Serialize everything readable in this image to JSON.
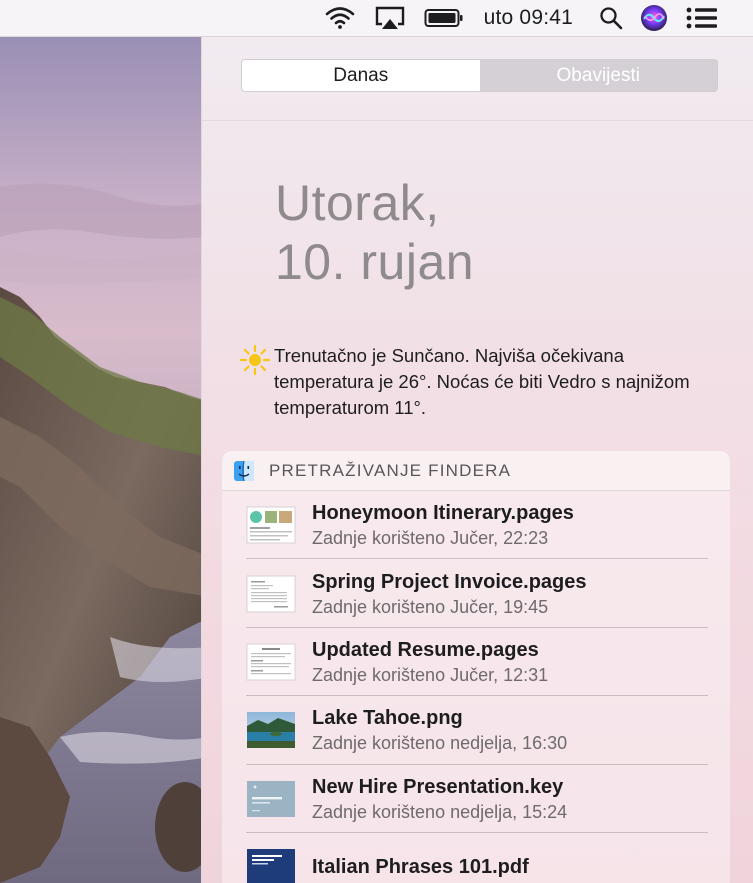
{
  "menubar": {
    "icons": [
      "wifi-icon",
      "airplay-icon",
      "battery-icon",
      "search-icon",
      "siri-icon",
      "notification-center-icon"
    ],
    "clock": "uto 09:41"
  },
  "panel": {
    "tabs": [
      {
        "label": "Danas",
        "active": true
      },
      {
        "label": "Obavijesti",
        "active": false
      }
    ],
    "date_line1": "Utorak,",
    "date_line2": "10. rujan",
    "weather": {
      "icon": "sun-icon",
      "text": "Trenutačno je Sunčano. Najviša očekivana temperatura je 26°. Noćas će biti Vedro s najnižom temperaturom 11°."
    },
    "finder_widget": {
      "icon": "finder-icon",
      "title": "PRETRAŽIVANJE FINDERA",
      "results": [
        {
          "name": "Honeymoon Itinerary.pages",
          "meta": "Zadnje korišteno Jučer, 22:23",
          "thumb": "pages-document-thumbnail"
        },
        {
          "name": "Spring Project Invoice.pages",
          "meta": "Zadnje korišteno Jučer, 19:45",
          "thumb": "pages-document-thumbnail"
        },
        {
          "name": "Updated Resume.pages",
          "meta": "Zadnje korišteno Jučer, 12:31",
          "thumb": "pages-document-thumbnail"
        },
        {
          "name": "Lake Tahoe.png",
          "meta": "Zadnje korišteno nedjelja, 16:30",
          "thumb": "image-thumbnail"
        },
        {
          "name": "New Hire Presentation.key",
          "meta": "Zadnje korišteno nedjelja, 15:24",
          "thumb": "keynote-thumbnail"
        },
        {
          "name": "Italian Phrases 101.pdf",
          "meta": "",
          "thumb": "pdf-thumbnail"
        }
      ]
    }
  },
  "colors": {
    "panel_top": "#f1ebf0",
    "panel_bottom": "#f0d4dc",
    "date_text": "#8e8a8e",
    "sun": "#f5c518"
  }
}
